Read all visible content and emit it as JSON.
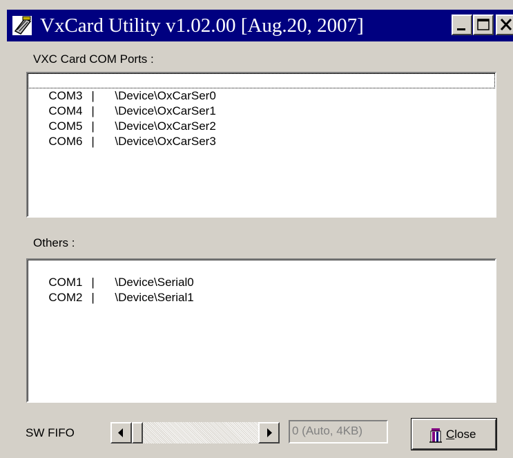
{
  "window": {
    "title": "VxCard Utility v1.02.00 [Aug.20, 2007]"
  },
  "vxc_section": {
    "label": "VXC Card COM Ports :",
    "items": [
      {
        "port": "COM3",
        "sep": "|",
        "device": "\\Device\\OxCarSer0"
      },
      {
        "port": "COM4",
        "sep": "|",
        "device": "\\Device\\OxCarSer1"
      },
      {
        "port": "COM5",
        "sep": "|",
        "device": "\\Device\\OxCarSer2"
      },
      {
        "port": "COM6",
        "sep": "|",
        "device": "\\Device\\OxCarSer3"
      }
    ]
  },
  "others_section": {
    "label": "Others :",
    "items": [
      {
        "port": "COM1",
        "sep": "|",
        "device": "\\Device\\Serial0"
      },
      {
        "port": "COM2",
        "sep": "|",
        "device": "\\Device\\Serial1"
      }
    ]
  },
  "sw_fifo": {
    "label": "SW FIFO",
    "value_text": "0 (Auto, 4KB)",
    "slider_position": 0
  },
  "close_button": {
    "label_first": "C",
    "label_rest": "lose",
    "icon": "door-exit-icon"
  },
  "colors": {
    "titlebar": "#000080",
    "face": "#d4d0c8"
  }
}
